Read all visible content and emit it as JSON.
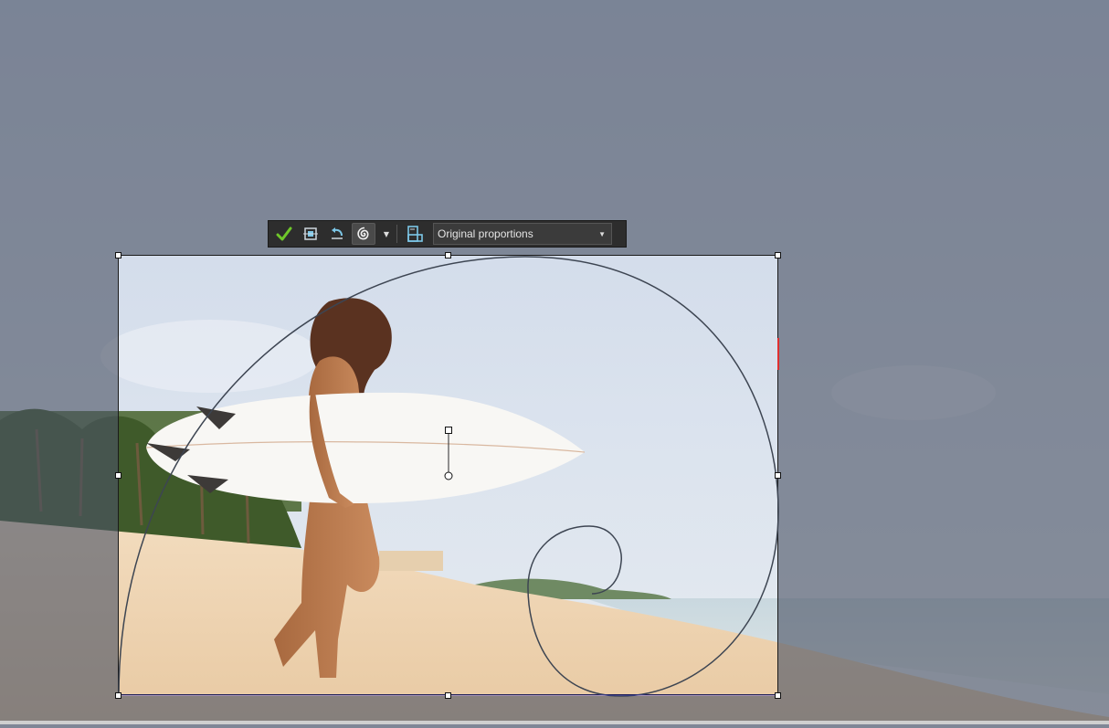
{
  "toolbar": {
    "buttons": [
      {
        "icon": "checkmark-icon",
        "title": "Apply"
      },
      {
        "icon": "crop-to-fit-icon",
        "title": "Fit"
      },
      {
        "icon": "rotate-icon",
        "title": "Rotate"
      },
      {
        "icon": "golden-spiral-icon",
        "title": "Overlay",
        "active": true
      }
    ],
    "overlay_menu_icon": "chevron-down-icon",
    "orientation_icon": "orientation-icon",
    "aspect_dropdown": {
      "selected": "Original proportions",
      "icon": "chevron-down-icon"
    }
  },
  "colors": {
    "toolbar_bg": "#2d2d2d",
    "check_green": "#6fc72a",
    "icon_blue": "#7cc7e8",
    "overlay_line": "#3d4552"
  }
}
